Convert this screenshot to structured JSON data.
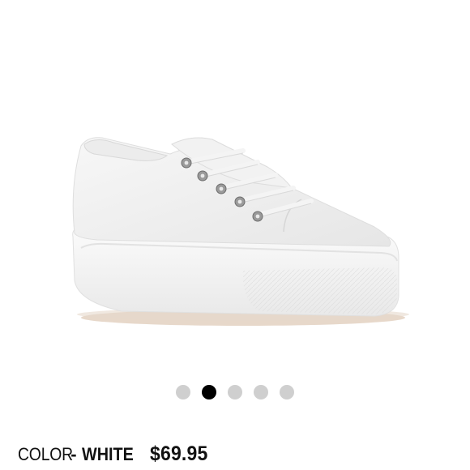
{
  "product": {
    "image_alt": "white platform canvas sneaker",
    "image_icon": "sneaker-photo"
  },
  "carousel": {
    "total": 5,
    "active_index": 1
  },
  "details": {
    "color_label": "COLOR",
    "color_dash": "-",
    "color_value": "WHITE",
    "price": "$69.95"
  },
  "colors": {
    "dot_inactive": "#cfcfcf",
    "dot_active": "#000000",
    "text": "#111111"
  }
}
